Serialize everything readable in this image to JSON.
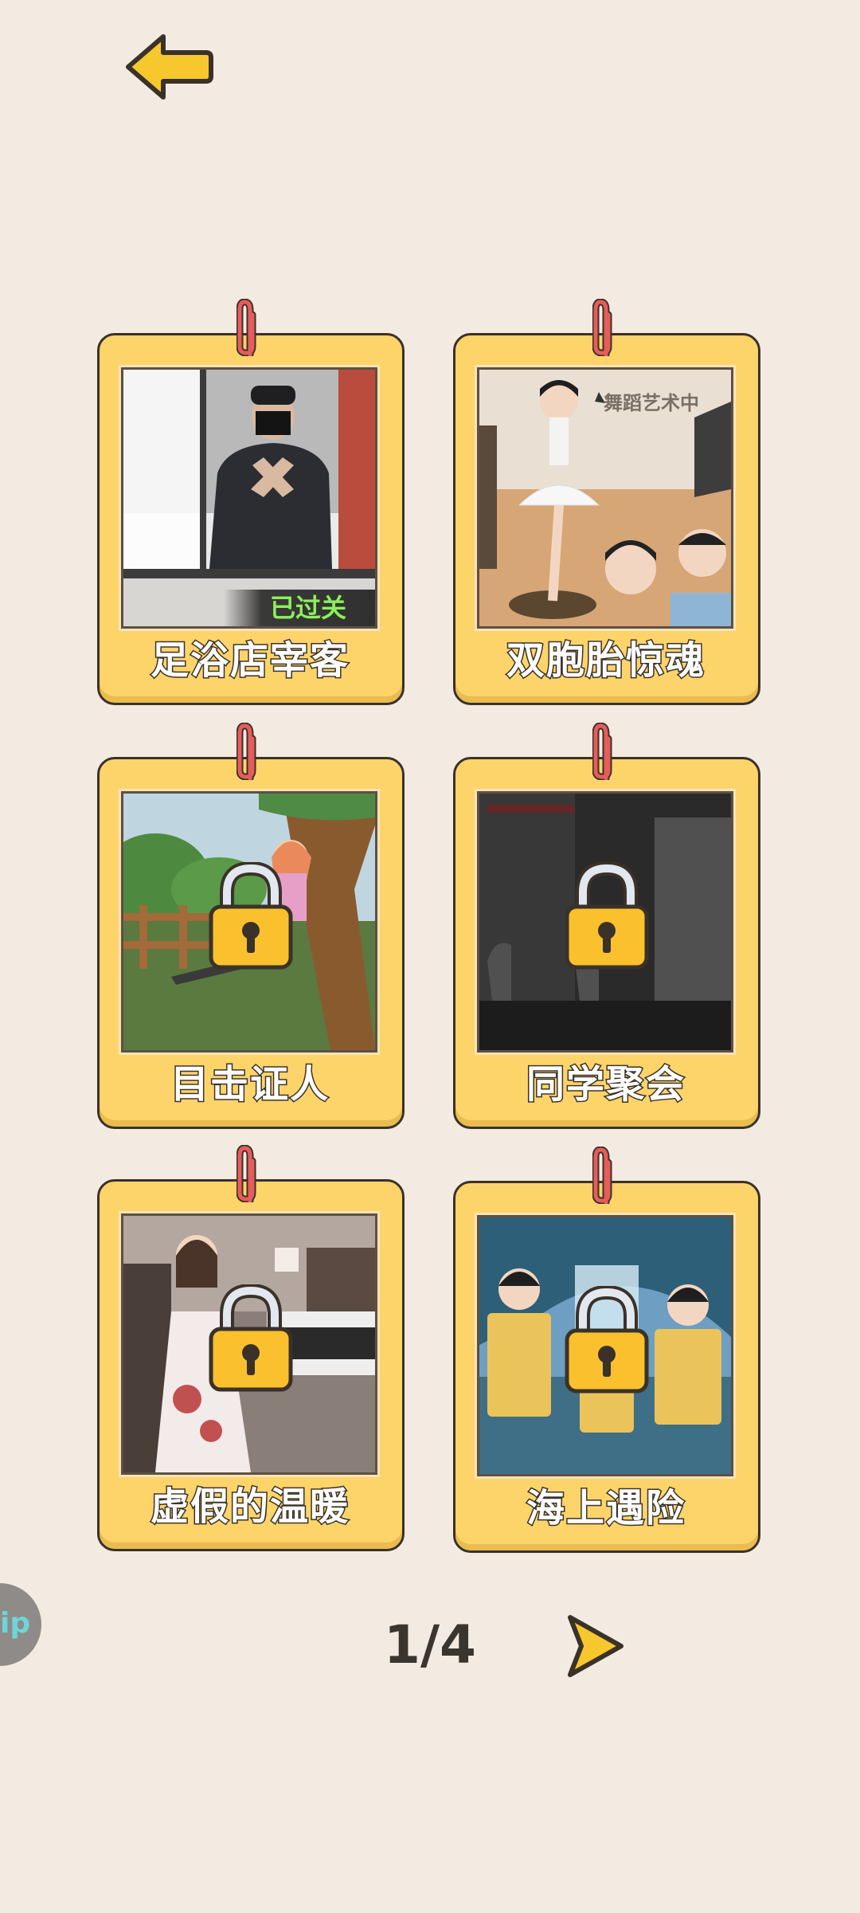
{
  "header": {
    "back_icon": "back-arrow-icon"
  },
  "levels": [
    {
      "title": "足浴店宰客",
      "status": "已过关",
      "locked": false
    },
    {
      "title": "双胞胎惊魂",
      "sign_text": "舞蹈艺术中",
      "locked": false
    },
    {
      "title": "目击证人",
      "locked": true
    },
    {
      "title": "同学聚会",
      "locked": true
    },
    {
      "title": "虚假的温暖",
      "locked": true
    },
    {
      "title": "海上遇险",
      "locked": true
    }
  ],
  "pager": {
    "current": "1/4",
    "next_icon": "next-arrow-icon"
  },
  "side_bubble": {
    "label": "ip"
  },
  "colors": {
    "background": "#f3ebe1",
    "card": "#fcd46a",
    "accent": "#f7c82d",
    "outline": "#3a3229",
    "passed": "#8cf05a"
  }
}
